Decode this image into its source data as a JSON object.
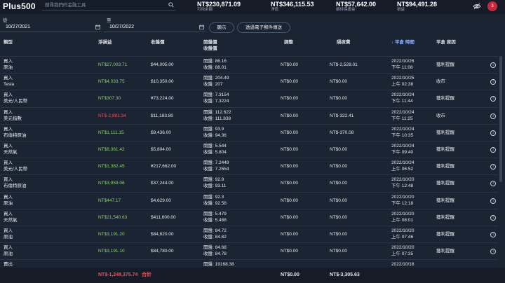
{
  "header": {
    "logo": "Plus500",
    "search_placeholder": "搜尋我們的金融工具",
    "stats": [
      {
        "value": "NT$230,871.09",
        "label": "可用余額"
      },
      {
        "value": "NT$346,115.53",
        "label": "淨值"
      },
      {
        "value": "NT$57,642.00",
        "label": "維持保證金"
      },
      {
        "value": "NT$94,491.28",
        "label": "損益"
      }
    ],
    "notification_count": "3"
  },
  "filters": {
    "from_label": "從",
    "from_value": "10/27/2021",
    "to_label": "至",
    "to_value": "10/27/2022",
    "show_button": "顯示",
    "email_button": "透過電子郵件傳送"
  },
  "columns": {
    "type": "類型",
    "pnl": "淨損益",
    "close_price": "收盤價",
    "open_close_1": "開盤價",
    "open_close_2": "收盤價",
    "adjust": "調整",
    "overnight": "隔夜費",
    "close_time": "↓ 平倉 時間",
    "close_reason": "平倉 原因"
  },
  "rows": [
    {
      "type1": "買入",
      "type2": "原油",
      "pnl": "NT$27,003.71",
      "pnl_neg": false,
      "close": "$44,005.00",
      "open": "開盤: 86.16",
      "closep": "收盤: 88.01",
      "adjust": "NT$0.00",
      "overnight": "NT$-2,528.01",
      "date": "2022/10/26",
      "time": "下午 11:08",
      "reason": "獲利提醒"
    },
    {
      "type1": "買入",
      "type2": "Tesla",
      "pnl": "NT$4,033.75",
      "pnl_neg": false,
      "close": "$10,350.00",
      "open": "開盤: 204.49",
      "closep": "收盤: 207",
      "adjust": "NT$0.00",
      "overnight": "NT$0.00",
      "date": "2022/10/25",
      "time": "上午 02:38",
      "reason": "收市"
    },
    {
      "type1": "買入",
      "type2": "美元/人民幣",
      "pnl": "NT$307.30",
      "pnl_neg": false,
      "close": "¥73,224.00",
      "open": "開盤: 7.3154",
      "closep": "收盤: 7.3224",
      "adjust": "NT$0.00",
      "overnight": "NT$0.00",
      "date": "2022/10/24",
      "time": "下午 11:44",
      "reason": "獲利提醒"
    },
    {
      "type1": "買入",
      "type2": "美元指數",
      "pnl": "NT$-2,881.34",
      "pnl_neg": true,
      "close": "$11,183.80",
      "open": "開盤: 112.622",
      "closep": "收盤: 111.838",
      "adjust": "NT$0.00",
      "overnight": "NT$-322.41",
      "date": "2022/10/24",
      "time": "下午 11:25",
      "reason": "收市"
    },
    {
      "type1": "買入",
      "type2": "布倫特原油",
      "pnl": "NT$1,111.15",
      "pnl_neg": false,
      "close": "$9,436.00",
      "open": "開盤: 93.9",
      "closep": "收盤: 94.36",
      "adjust": "NT$0.00",
      "overnight": "NT$-370.08",
      "date": "2022/10/24",
      "time": "下午 10:35",
      "reason": "獲利提醒"
    },
    {
      "type1": "買入",
      "type2": "天然氣",
      "pnl": "NT$8,361.42",
      "pnl_neg": false,
      "close": "$5,804.00",
      "open": "開盤: 5.544",
      "closep": "收盤: 5.804",
      "adjust": "NT$0.00",
      "overnight": "NT$0.00",
      "date": "2022/10/24",
      "time": "下午 09:40",
      "reason": "獲利提醒"
    },
    {
      "type1": "買入",
      "type2": "美元/人民幣",
      "pnl": "NT$1,382.45",
      "pnl_neg": false,
      "close": "¥217,662.00",
      "open": "開盤: 7.2449",
      "closep": "收盤: 7.2554",
      "adjust": "NT$0.00",
      "overnight": "NT$0.00",
      "date": "2022/10/24",
      "time": "上午 06:52",
      "reason": "獲利提醒"
    },
    {
      "type1": "買入",
      "type2": "布倫特原油",
      "pnl": "NT$3,959.06",
      "pnl_neg": false,
      "close": "$37,244.00",
      "open": "開盤: 92.8",
      "closep": "收盤: 93.11",
      "adjust": "NT$0.00",
      "overnight": "NT$0.00",
      "date": "2022/10/20",
      "time": "下午 12:48",
      "reason": "獲利提醒"
    },
    {
      "type1": "買入",
      "type2": "原油",
      "pnl": "NT$447.17",
      "pnl_neg": false,
      "close": "$4,629.00",
      "open": "開盤: 92.3",
      "closep": "收盤: 92.58",
      "adjust": "NT$0.00",
      "overnight": "NT$0.00",
      "date": "2022/10/20",
      "time": "下午 12:18",
      "reason": "獲利提醒"
    },
    {
      "type1": "買入",
      "type2": "天然氣",
      "pnl": "NT$21,540.63",
      "pnl_neg": false,
      "close": "$411,600.00",
      "open": "開盤: 5.479",
      "closep": "收盤: 5.488",
      "adjust": "NT$0.00",
      "overnight": "NT$0.00",
      "date": "2022/10/20",
      "time": "上午 08:01",
      "reason": "獲利提醒"
    },
    {
      "type1": "買入",
      "type2": "原油",
      "pnl": "NT$3,191.20",
      "pnl_neg": false,
      "close": "$84,820.00",
      "open": "開盤: 84.72",
      "closep": "收盤: 84.82",
      "adjust": "NT$0.00",
      "overnight": "NT$0.00",
      "date": "2022/10/20",
      "time": "上午 07:46",
      "reason": "獲利提醒"
    },
    {
      "type1": "買入",
      "type2": "原油",
      "pnl": "NT$3,191.10",
      "pnl_neg": false,
      "close": "$84,780.00",
      "open": "開盤: 84.68",
      "closep": "收盤: 84.78",
      "adjust": "NT$0.00",
      "overnight": "NT$0.00",
      "date": "2022/10/20",
      "time": "上午 07:35",
      "reason": "獲利提醒"
    },
    {
      "type1": "賣出",
      "type2": "",
      "pnl": "",
      "pnl_neg": false,
      "close": "",
      "open": "開盤: 19168.38",
      "closep": "",
      "adjust": "",
      "overnight": "",
      "date": "2022/10/16",
      "time": "",
      "reason": ""
    }
  ],
  "footer": {
    "total_pnl": "NT$-1,248,375.74",
    "total_label": "合計",
    "total_adjust": "NT$0.00",
    "total_overnight": "NT$-3,305.63"
  },
  "colors": {
    "positive": "#8bd16d",
    "negative": "#f0505a",
    "background": "#1b2433"
  }
}
